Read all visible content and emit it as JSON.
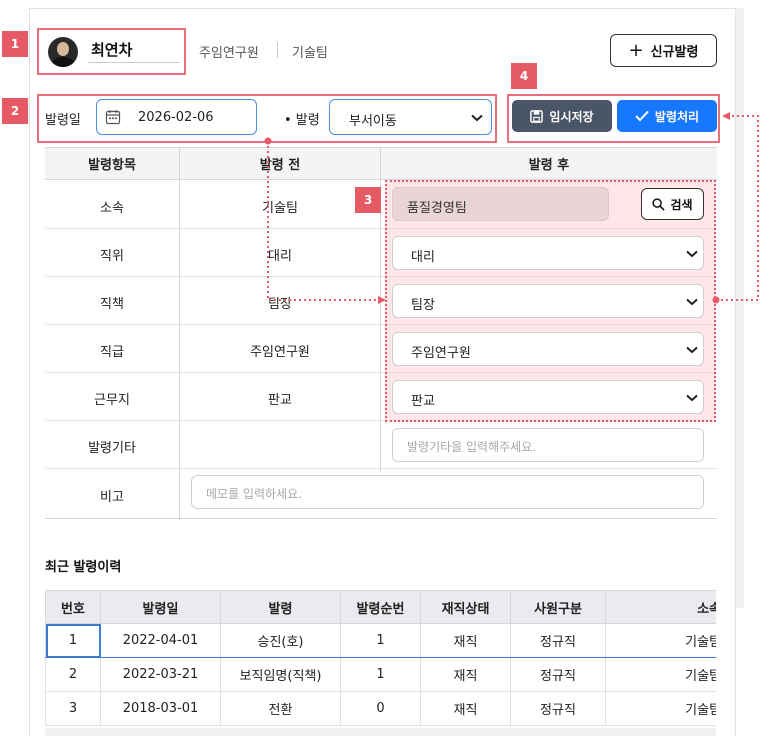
{
  "employee": {
    "name": "최연차",
    "grade": "주임연구원",
    "team": "기술팀"
  },
  "toolbar": {
    "new_issue_label": "신규발령",
    "save_draft_label": "임시저장",
    "process_label": "발령처리"
  },
  "form": {
    "date_label": "발령일",
    "date_value": "2026-02-06",
    "type_label": "• 발령",
    "type_value": "부서이동"
  },
  "grid": {
    "headers": [
      "발령항목",
      "발령 전",
      "발령 후"
    ],
    "rows": [
      {
        "label": "소속",
        "before": "기술팀",
        "after": "품질경영팀"
      },
      {
        "label": "직위",
        "before": "대리",
        "after": "대리"
      },
      {
        "label": "직책",
        "before": "팀장",
        "after": "팀장"
      },
      {
        "label": "직급",
        "before": "주임연구원",
        "after": "주임연구원"
      },
      {
        "label": "근무지",
        "before": "판교",
        "after": "판교"
      },
      {
        "label": "발령기타",
        "before": "",
        "after_placeholder": "발령기타을 입력해주세요."
      },
      {
        "label": "비고",
        "placeholder": "메모를 입력하세요."
      }
    ],
    "search_label": "검색"
  },
  "history": {
    "title": "최근 발령이력",
    "columns": [
      "번호",
      "발령일",
      "발령",
      "발령순번",
      "재직상태",
      "사원구분",
      "소속"
    ],
    "rows": [
      [
        "1",
        "2022-04-01",
        "승진(호)",
        "1",
        "재직",
        "정규직",
        "기술팀"
      ],
      [
        "2",
        "2022-03-21",
        "보직임명(직책)",
        "1",
        "재직",
        "정규직",
        "기술팀"
      ],
      [
        "3",
        "2018-03-01",
        "전환",
        "0",
        "재직",
        "정규직",
        "기술팀"
      ]
    ]
  },
  "annotations": [
    "1",
    "2",
    "3",
    "4"
  ],
  "colors": {
    "primary": "#1677ff",
    "secondary": "#4a5568",
    "annotation": "#e65a66",
    "highlight": "#ffc8cd"
  },
  "icons": {
    "calendar": "calendar-icon",
    "save": "floppy-disk-icon",
    "check": "check-icon",
    "plus": "plus-icon",
    "search": "magnifier-icon",
    "dropdown": "chevron-down-icon"
  }
}
